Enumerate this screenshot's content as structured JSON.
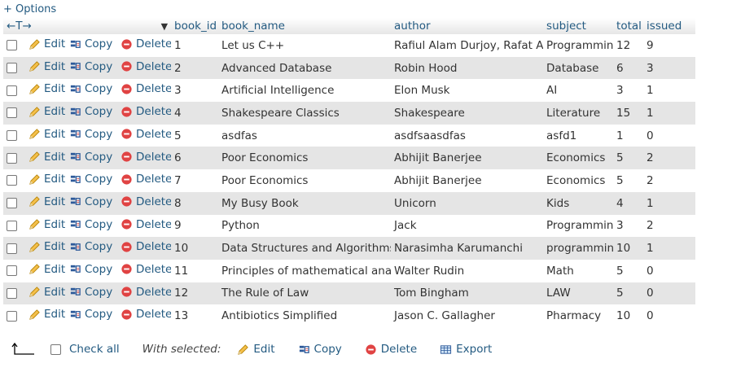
{
  "options_link": "+ Options",
  "header": {
    "nav_arrows": "←T→",
    "columns": [
      "book_id",
      "book_name",
      "author",
      "subject",
      "total",
      "issued"
    ]
  },
  "actions": {
    "edit": "Edit",
    "copy": "Copy",
    "delete": "Delete"
  },
  "rows": [
    {
      "book_id": "1",
      "book_name": "Let us C++",
      "author": "Rafiul Alam Durjoy, Rafat Azad",
      "subject": "Programming",
      "total": "12",
      "issued": "9"
    },
    {
      "book_id": "2",
      "book_name": "Advanced Database",
      "author": "Robin Hood",
      "subject": "Database",
      "total": "6",
      "issued": "3"
    },
    {
      "book_id": "3",
      "book_name": "Artificial Intelligence",
      "author": "Elon Musk",
      "subject": "AI",
      "total": "3",
      "issued": "1"
    },
    {
      "book_id": "4",
      "book_name": "Shakespeare Classics",
      "author": "Shakespeare",
      "subject": "Literature",
      "total": "15",
      "issued": "1"
    },
    {
      "book_id": "5",
      "book_name": "asdfas",
      "author": "asdfsaasdfas",
      "subject": "asfd1",
      "total": "1",
      "issued": "0"
    },
    {
      "book_id": "6",
      "book_name": "Poor Economics",
      "author": "Abhijit Banerjee",
      "subject": "Economics",
      "total": "5",
      "issued": "2"
    },
    {
      "book_id": "7",
      "book_name": "Poor Economics",
      "author": "Abhijit Banerjee",
      "subject": "Economics",
      "total": "5",
      "issued": "2"
    },
    {
      "book_id": "8",
      "book_name": "My Busy Book",
      "author": "Unicorn",
      "subject": "Kids",
      "total": "4",
      "issued": "1"
    },
    {
      "book_id": "9",
      "book_name": "Python",
      "author": "Jack",
      "subject": "Programming",
      "total": "3",
      "issued": "2"
    },
    {
      "book_id": "10",
      "book_name": "Data Structures and Algorithms",
      "author": "Narasimha Karumanchi",
      "subject": "programming",
      "total": "10",
      "issued": "1"
    },
    {
      "book_id": "11",
      "book_name": "Principles of mathematical analysis",
      "author": "Walter Rudin",
      "subject": "Math",
      "total": "5",
      "issued": "0"
    },
    {
      "book_id": "12",
      "book_name": "The Rule of Law",
      "author": "Tom Bingham",
      "subject": "LAW",
      "total": "5",
      "issued": "0"
    },
    {
      "book_id": "13",
      "book_name": "Antibiotics Simplified",
      "author": "Jason C. Gallagher",
      "subject": "Pharmacy",
      "total": "10",
      "issued": "0"
    }
  ],
  "footer": {
    "check_all": "Check all",
    "with_selected": "With selected:",
    "edit": "Edit",
    "copy": "Copy",
    "delete": "Delete",
    "export": "Export"
  },
  "icons": {
    "edit": "pencil-icon",
    "copy": "copy-icon",
    "delete": "delete-icon",
    "export": "export-icon",
    "sort": "sort-down-icon",
    "check_all_arrow": "arrow-up-left-icon"
  },
  "colors": {
    "link": "#235a81",
    "row_even": "#e5e5e5",
    "row_odd": "#ffffff",
    "delete_red": "#e04343"
  }
}
